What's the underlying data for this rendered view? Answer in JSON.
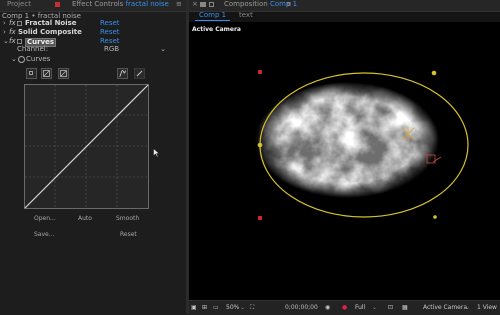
{
  "left_panel": {
    "tab_project": "Project",
    "tab_effect_controls_label": "Effect Controls",
    "tab_effect_controls_layer": "fractal noise",
    "breadcrumb": "Comp 1 • fractal noise",
    "effects": [
      {
        "name": "Fractal Noise",
        "reset": "Reset"
      },
      {
        "name": "Solid Composite",
        "reset": "Reset"
      },
      {
        "name": "Curves",
        "reset": "Reset"
      }
    ],
    "channel_label": "Channel:",
    "channel_value": "RGB",
    "curves_prop": "Curves",
    "buttons": {
      "open": "Open...",
      "auto": "Auto",
      "smooth": "Smooth",
      "save": "Save...",
      "reset": "Reset"
    }
  },
  "right_panel": {
    "tab_composition_label": "Composition",
    "tab_composition_name": "Comp 1",
    "comp_tab": "Comp 1",
    "layer_tab": "text",
    "viewer_label": "Active Camera"
  },
  "status_bar": {
    "zoom": "50%",
    "timecode": "0;00;00;00",
    "resolution": "Full",
    "view": "Active Camera",
    "views": "1 View"
  },
  "colors": {
    "accent_blue": "#3b8ff0",
    "mask_yellow": "#d8c22a",
    "panel_bg": "#1d1d1d"
  }
}
